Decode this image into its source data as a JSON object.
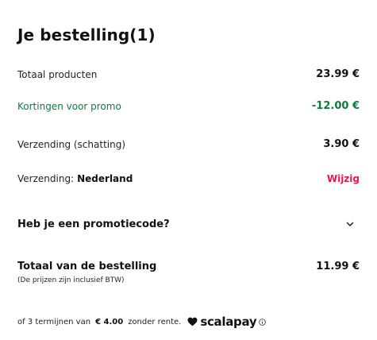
{
  "order": {
    "title": "Je bestelling(1)",
    "total_products_label": "Totaal producten",
    "total_products_value": "23.99 €",
    "discount_label": "Kortingen voor promo",
    "discount_value": "-12.00 €",
    "shipping_label": "Verzending (schatting)",
    "shipping_value": "3.90 €",
    "country_label": "Verzending:",
    "country_value": "Nederland",
    "change_label": "Wijzig",
    "promo_label": "Heb je een promotiecode?",
    "total_label": "Totaal van de bestelling",
    "vat_note": "(De prijzen zijn inclusief BTW)",
    "total_value": "11.99 €"
  },
  "installments": {
    "prefix": "of 3 termijnen van",
    "amount": "€ 4.00",
    "suffix": "zonder rente.",
    "brand": "scalapay"
  },
  "colors": {
    "discount": "#0a7d3b",
    "link": "#e6194b",
    "text": "#111111"
  },
  "icons": {
    "promo_toggle": "chevron-down-icon",
    "brand_mark": "heart-icon",
    "info": "info-icon"
  }
}
